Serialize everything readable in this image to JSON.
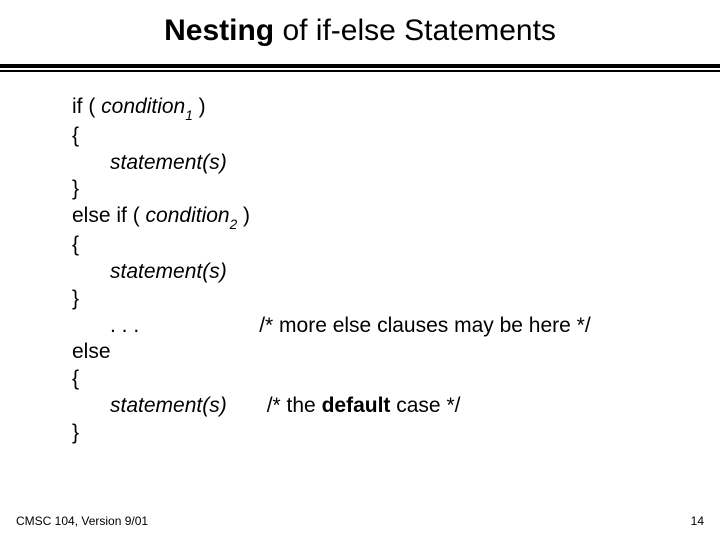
{
  "title": {
    "bold": "Nesting",
    "rest": " of if-else Statements"
  },
  "code": {
    "if_kw": "if ( ",
    "cond": "condition",
    "sub1": "1",
    "close_paren": " )",
    "lbrace": "{",
    "stmt": "statement(s)",
    "rbrace": "}",
    "elseif_kw": "else if ( ",
    "sub2": "2",
    "dots": ". . .",
    "comment1": "/* more else clauses may be here */",
    "else_kw": "else",
    "comment2_pre": "/* the ",
    "comment2_bold": "default",
    "comment2_post": " case */"
  },
  "footer": {
    "left": "CMSC 104, Version 9/01",
    "right": "14"
  }
}
